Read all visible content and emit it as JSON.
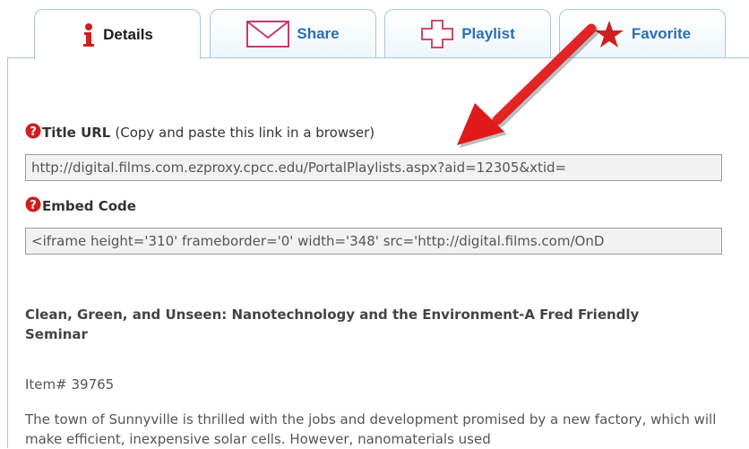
{
  "tabs": [
    {
      "label": "Details",
      "icon": "info-icon",
      "active": true
    },
    {
      "label": "Share",
      "icon": "envelope-icon",
      "active": false
    },
    {
      "label": "Playlist",
      "icon": "plus-icon",
      "active": false
    },
    {
      "label": "Favorite",
      "icon": "star-icon",
      "active": false
    }
  ],
  "title_url": {
    "label": "Title URL",
    "note": "(Copy and paste this link in a browser)",
    "value": "http://digital.films.com.ezproxy.cpcc.edu/PortalPlaylists.aspx?aid=12305&xtid="
  },
  "embed_code": {
    "label": "Embed Code",
    "value": "<iframe height='310' frameborder='0' width='348' src='http://digital.films.com/OnD"
  },
  "video": {
    "title": "Clean, Green, and Unseen: Nanotechnology and the Environment-A Fred Friendly Seminar",
    "item_number": "Item# 39765",
    "description": "The town of Sunnyville is thrilled with the jobs and development promised by a new factory, which will make efficient, inexpensive solar cells. However, nanomaterials used"
  },
  "colors": {
    "tab_border": "#a9c6d8",
    "tab_link": "#2c6eb5",
    "help_icon": "#cc1f1f",
    "arrow": "#e01a1a",
    "field_bg": "#f2f2f2"
  }
}
